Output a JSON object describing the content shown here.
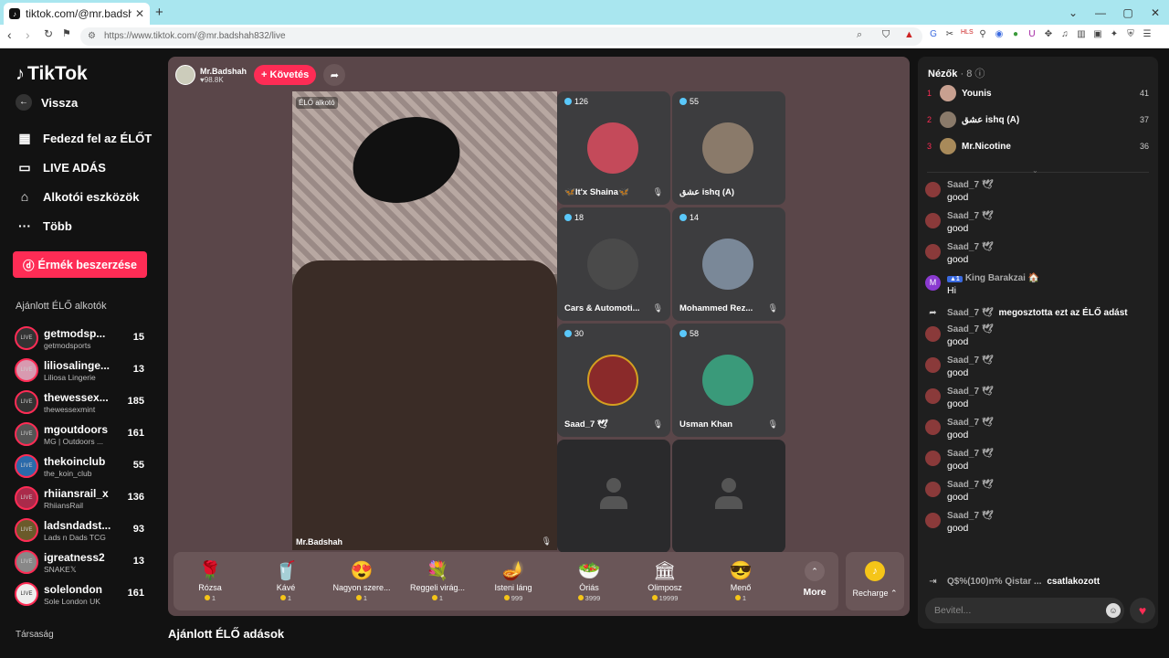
{
  "browser": {
    "tab_title": "tiktok.com/@mr.badshah832",
    "url": "https://www.tiktok.com/@mr.badshah832/live",
    "new_tab": "+",
    "tab_close": "✕"
  },
  "sidebar": {
    "logo": "TikTok",
    "nav": [
      {
        "label": "Vissza",
        "icon": "back-arrow-icon"
      },
      {
        "label": "Fedezd fel az ÉLŐT",
        "icon": "calendar-icon"
      },
      {
        "label": "LIVE ADÁS",
        "icon": "video-camera-icon"
      },
      {
        "label": "Alkotói eszközök",
        "icon": "house-icon"
      },
      {
        "label": "Több",
        "icon": "more-dots-icon"
      }
    ],
    "coins_button": "Érmék beszerzése",
    "recommended_heading": "Ajánlott ÉLŐ alkotók",
    "creators": [
      {
        "name": "getmodsp...",
        "sub": "getmodsports",
        "count": "15"
      },
      {
        "name": "liliosalinge...",
        "sub": "Liliosa Lingerie",
        "count": "13"
      },
      {
        "name": "thewessex...",
        "sub": "thewessexmint",
        "count": "185"
      },
      {
        "name": "mgoutdoors",
        "sub": "MG | Outdoors ...",
        "count": "161"
      },
      {
        "name": "thekoinclub",
        "sub": "the_koin_club",
        "count": "55"
      },
      {
        "name": "rhiiansrail_x",
        "sub": "RhiiansRail",
        "count": "136"
      },
      {
        "name": "ladsndadst...",
        "sub": "Lads n Dads TCG",
        "count": "93"
      },
      {
        "name": "igreatness2",
        "sub": "SNAKE𝕏",
        "count": "13"
      },
      {
        "name": "solelondon",
        "sub": "Sole London UK",
        "count": "161"
      }
    ],
    "companion": "Társaság"
  },
  "stage": {
    "host_name": "Mr.Badshah",
    "host_likes": "♥98.8K",
    "follow_button": "+ Követés",
    "live_tag": "ÉLŐ alkotó",
    "host_label": "Mr.Badshah",
    "guests": [
      {
        "count": "126",
        "name": "🦋It'x Shaina🦋",
        "avatar_color": "#c44a5a"
      },
      {
        "count": "55",
        "name": "عشق ishq (A)",
        "avatar_color": "#8a7a6a"
      },
      {
        "count": "18",
        "name": "Cars & Automoti...",
        "avatar_color": "#4a4a4a"
      },
      {
        "count": "14",
        "name": "Mohammed Rez...",
        "avatar_color": "#7a8898"
      },
      {
        "count": "30",
        "name": "Saad_7 🕊",
        "avatar_color": "#8a2a2a"
      },
      {
        "count": "58",
        "name": "Usman Khan",
        "avatar_color": "#3a9a7a"
      }
    ],
    "gifts": [
      {
        "name": "Rózsa",
        "price": "1",
        "icon": "🌹"
      },
      {
        "name": "Kávé",
        "price": "1",
        "icon": "🥤"
      },
      {
        "name": "Nagyon szere...",
        "price": "1",
        "icon": "😍"
      },
      {
        "name": "Reggeli virág...",
        "price": "1",
        "icon": "💐"
      },
      {
        "name": "Isteni láng",
        "price": "999",
        "icon": "🪔"
      },
      {
        "name": "Óriás",
        "price": "3999",
        "icon": "🥗"
      },
      {
        "name": "Olimposz",
        "price": "19999",
        "icon": "🏛"
      },
      {
        "name": "Menő",
        "price": "1",
        "icon": "😎"
      }
    ],
    "more_label": "More",
    "recharge_label": "Recharge ⌃"
  },
  "recommended_live_heading": "Ajánlott ÉLŐ adások",
  "viewers_panel": {
    "heading": "Nézők",
    "count": "· 8",
    "top": [
      {
        "rank": "1",
        "name": "Younis",
        "score": "41"
      },
      {
        "rank": "2",
        "name": "عشق ishq (A)",
        "score": "37"
      },
      {
        "rank": "3",
        "name": "Mr.Nicotine",
        "score": "36"
      }
    ]
  },
  "chat": {
    "messages": [
      {
        "user": "Saad_7 🕊",
        "text": "good"
      },
      {
        "user": "Saad_7 🕊",
        "text": "good"
      },
      {
        "user": "Saad_7 🕊",
        "text": "good"
      },
      {
        "user": "King Barakzai 🏠",
        "text": "Hi",
        "badge": "▲1"
      },
      {
        "user": "Saad_7 🕊",
        "text": "megosztotta ezt az ÉLŐ adást",
        "system": true
      },
      {
        "user": "Saad_7 🕊",
        "text": "good"
      },
      {
        "user": "Saad_7 🕊",
        "text": "good"
      },
      {
        "user": "Saad_7 🕊",
        "text": "good"
      },
      {
        "user": "Saad_7 🕊",
        "text": "good"
      },
      {
        "user": "Saad_7 🕊",
        "text": "good"
      },
      {
        "user": "Saad_7 🕊",
        "text": "good"
      },
      {
        "user": "Saad_7 🕊",
        "text": "good"
      }
    ],
    "joined_user": "Q$%(100)n% Qistar ...",
    "joined_text": "csatlakozott",
    "input_placeholder": "Bevitel..."
  },
  "colors": {
    "accent": "#fe2c55",
    "stage_bg": "#5a4649",
    "panel_bg": "#1f1f1f"
  }
}
